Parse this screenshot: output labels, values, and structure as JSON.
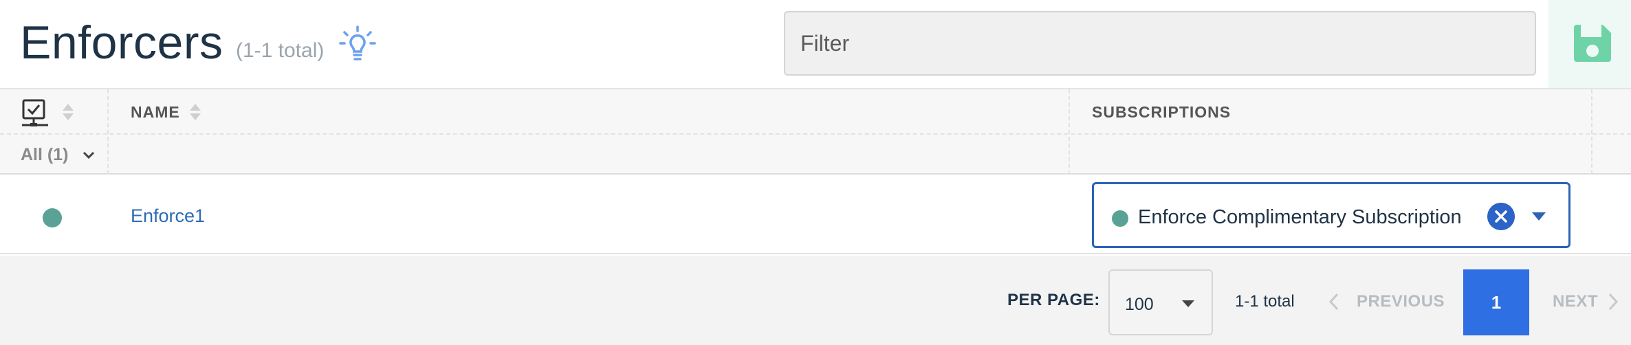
{
  "header": {
    "title": "Enforcers",
    "total": "(1-1 total)",
    "filter_placeholder": "Filter"
  },
  "table": {
    "columns": [
      {
        "label": "",
        "icon": "monitor-check-icon"
      },
      {
        "label": "NAME"
      },
      {
        "label": "SUBSCRIPTIONS"
      }
    ],
    "status_filter": "All (1)",
    "rows": [
      {
        "status_color": "#5aa295",
        "name": "Enforce1",
        "subscription": "Enforce Complimentary Subscription",
        "subscription_color": "#5aa295"
      }
    ]
  },
  "pagination": {
    "per_page_label": "PER PAGE:",
    "per_page_value": "100",
    "total_text": "1-1 total",
    "previous_label": "PREVIOUS",
    "current_page": "1",
    "next_label": "NEXT"
  },
  "colors": {
    "accent_blue": "#2f6fe4",
    "link_blue": "#2f6cb3",
    "status_green": "#5aa295",
    "save_green": "#6fd3a8",
    "bulb_blue": "#6aa1f0"
  }
}
